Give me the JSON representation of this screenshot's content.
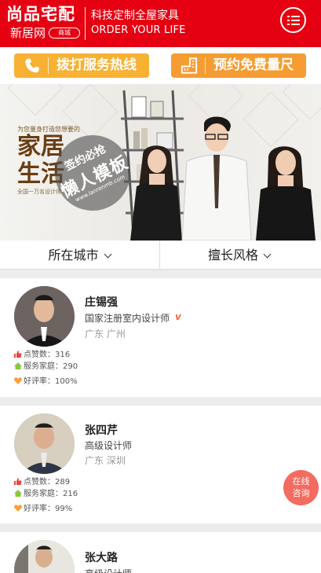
{
  "header": {
    "logo_main": "尚品宅配",
    "logo_sub": "新居网",
    "logo_badge": "商城",
    "tagline": "科技定制全屋家具",
    "tagline_en": "ORDER YOUR LIFE",
    "brand_color": "#e50012"
  },
  "actions": {
    "call_label": "拨打服务热线",
    "measure_label": "预约免费量尺",
    "call_icon": "phone-icon",
    "measure_icon": "ruler-icon"
  },
  "banner": {
    "small_text": "为您量身打造您想要的",
    "big_text_1": "家居",
    "big_text_2": "生活",
    "foot_text": "全国一万名设计师",
    "stamp_line1": "签约必抢",
    "stamp_line2": "懒人模板",
    "stamp_line3": "www.lanrenmb.com"
  },
  "filters": {
    "city_label": "所在城市",
    "style_label": "擅长风格"
  },
  "designers": [
    {
      "name": "庄锡强",
      "title": "国家注册室内设计师",
      "verified": "v",
      "location": "广东  广州",
      "likes_label": "点赞数：",
      "likes": "316",
      "homes_label": "服务家庭：",
      "homes": "290",
      "rating_label": "好评率：",
      "rating": "100%"
    },
    {
      "name": "张四芹",
      "title": "高级设计师",
      "location": "广东  深圳",
      "likes_label": "点赞数：",
      "likes": "289",
      "homes_label": "服务家庭：",
      "homes": "216",
      "rating_label": "好评率：",
      "rating": "99%"
    },
    {
      "name": "张大路",
      "title": "高级设计师"
    }
  ],
  "consult": {
    "line1": "在线",
    "line2": "咨询"
  }
}
